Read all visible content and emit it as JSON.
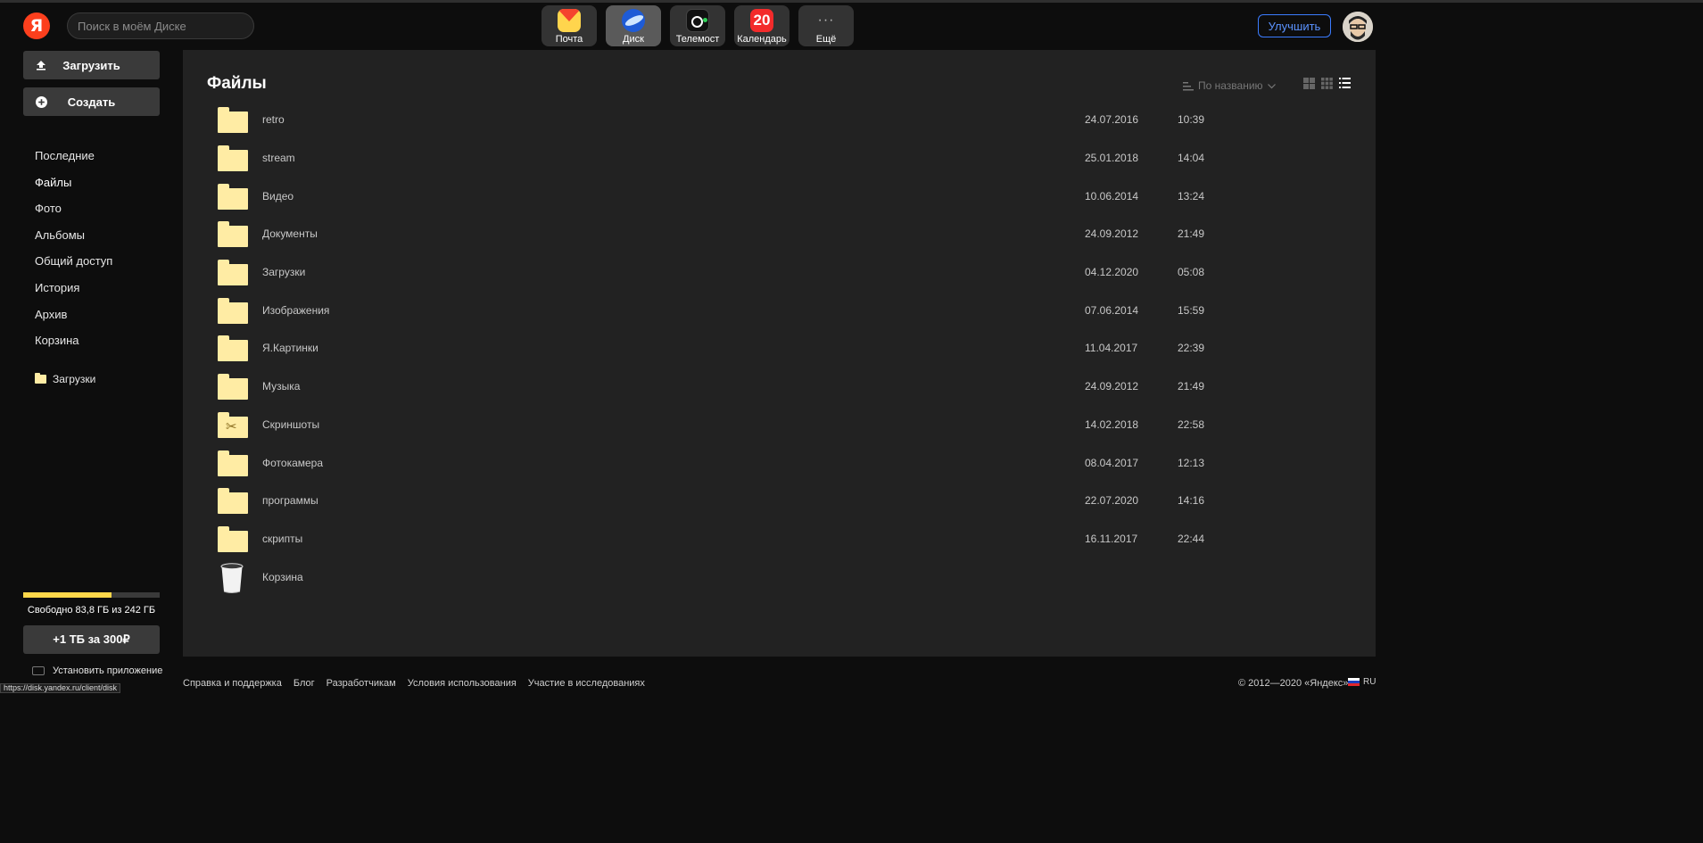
{
  "header": {
    "logo_letter": "Я",
    "search_placeholder": "Поиск в моём Диске",
    "apps": [
      {
        "label": "Почта"
      },
      {
        "label": "Диск"
      },
      {
        "label": "Телемост"
      },
      {
        "label": "Календарь",
        "badge": "20"
      },
      {
        "label": "Ещё",
        "glyph": "···"
      }
    ],
    "upgrade_label": "Улучшить"
  },
  "sidebar": {
    "upload_label": "Загрузить",
    "create_label": "Создать",
    "nav": [
      "Последние",
      "Файлы",
      "Фото",
      "Альбомы",
      "Общий доступ",
      "История",
      "Архив",
      "Корзина"
    ],
    "active_nav": "Файлы",
    "favorites": [
      "Загрузки"
    ],
    "storage": {
      "used_fraction": 0.65,
      "text": "Свободно 83,8 ГБ из 242 ГБ"
    },
    "buy_label": "+1 ТБ за 300₽",
    "install_label": "Установить приложение"
  },
  "main": {
    "title": "Файлы",
    "sort_label": "По названию",
    "files": [
      {
        "name": "retro",
        "date": "24.07.2016",
        "time": "10:39",
        "type": "folder"
      },
      {
        "name": "stream",
        "date": "25.01.2018",
        "time": "14:04",
        "type": "folder"
      },
      {
        "name": "Видео",
        "date": "10.06.2014",
        "time": "13:24",
        "type": "folder"
      },
      {
        "name": "Документы",
        "date": "24.09.2012",
        "time": "21:49",
        "type": "folder"
      },
      {
        "name": "Загрузки",
        "date": "04.12.2020",
        "time": "05:08",
        "type": "folder"
      },
      {
        "name": "Изображения",
        "date": "07.06.2014",
        "time": "15:59",
        "type": "folder"
      },
      {
        "name": "Я.Картинки",
        "date": "11.04.2017",
        "time": "22:39",
        "type": "folder"
      },
      {
        "name": "Музыка",
        "date": "24.09.2012",
        "time": "21:49",
        "type": "folder"
      },
      {
        "name": "Скриншоты",
        "date": "14.02.2018",
        "time": "22:58",
        "type": "screenshots"
      },
      {
        "name": "Фотокамера",
        "date": "08.04.2017",
        "time": "12:13",
        "type": "folder"
      },
      {
        "name": "программы",
        "date": "22.07.2020",
        "time": "14:16",
        "type": "folder"
      },
      {
        "name": "скрипты",
        "date": "16.11.2017",
        "time": "22:44",
        "type": "folder"
      },
      {
        "name": "Корзина",
        "date": "",
        "time": "",
        "type": "trash"
      }
    ]
  },
  "footer": {
    "links": [
      "Справка и поддержка",
      "Блог",
      "Разработчикам",
      "Условия использования",
      "Участие в исследованиях"
    ],
    "copyright": "© 2012—2020 «Яндекс»",
    "lang": "RU"
  },
  "status_url": "https://disk.yandex.ru/client/disk",
  "colors": {
    "accent": "#3b7cff",
    "folder": "#ffeca4",
    "storage": "#ffd74a",
    "logo": "#fc3f1d"
  }
}
